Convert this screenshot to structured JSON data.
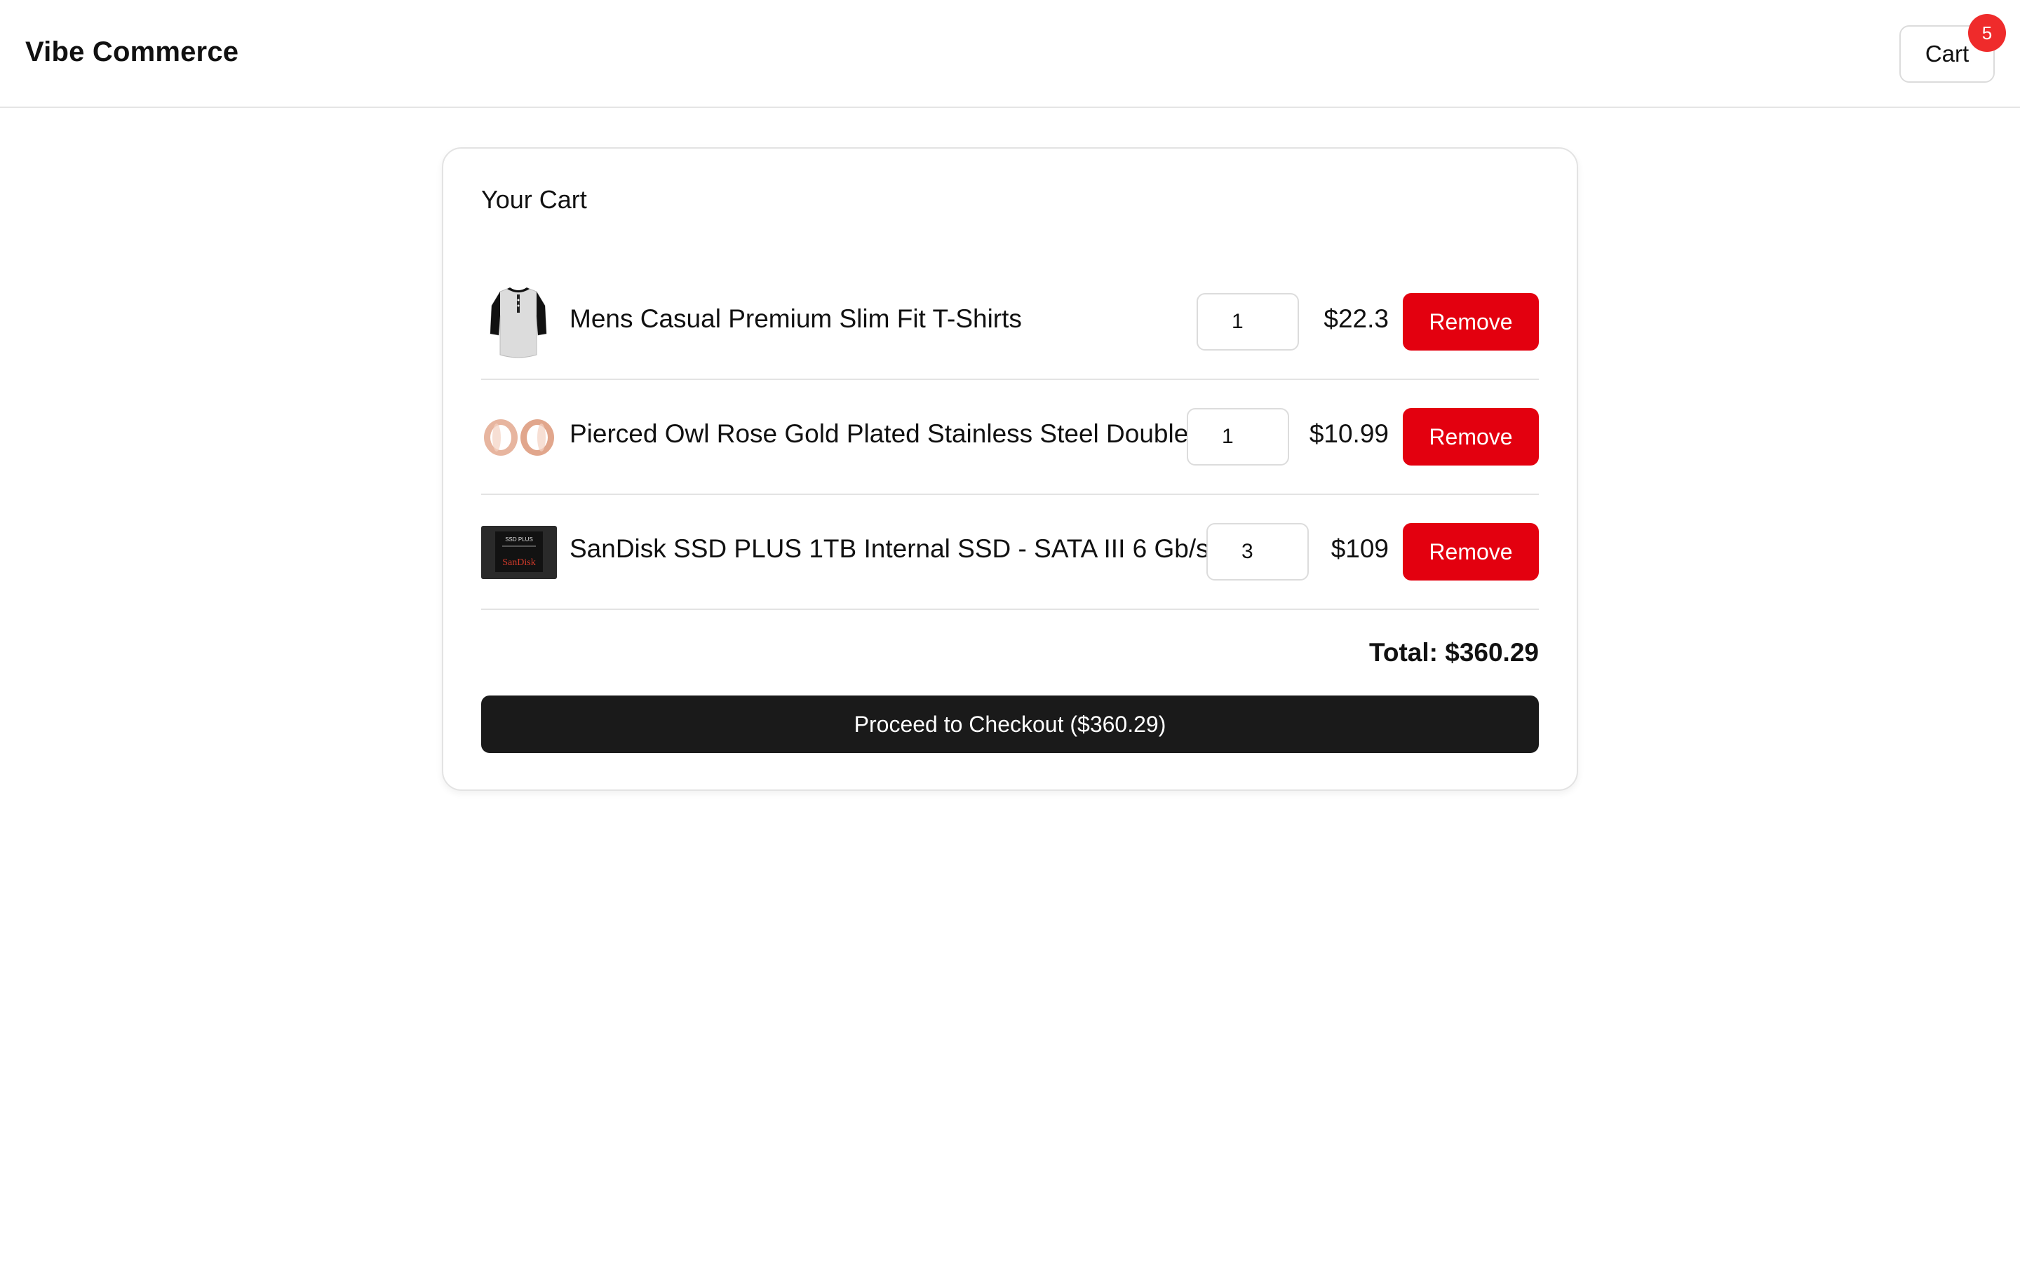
{
  "header": {
    "brand": "Vibe Commerce",
    "cart_label": "Cart",
    "cart_count": "5"
  },
  "cart": {
    "title": "Your Cart",
    "items": [
      {
        "name": "Mens Casual Premium Slim Fit T-Shirts",
        "quantity": "1",
        "price": "$22.3",
        "remove_label": "Remove",
        "image_icon": "tshirt-icon"
      },
      {
        "name": "Pierced Owl Rose Gold Plated Stainless Steel Double",
        "quantity": "1",
        "price": "$10.99",
        "remove_label": "Remove",
        "image_icon": "rings-icon"
      },
      {
        "name": "SanDisk SSD PLUS 1TB Internal SSD - SATA III 6 Gb/s",
        "quantity": "3",
        "price": "$109",
        "remove_label": "Remove",
        "image_icon": "ssd-icon",
        "image_label_top": "SSD PLUS",
        "image_label_brand": "SanDisk"
      }
    ],
    "total_label": "Total: $360.29",
    "checkout_label": "Proceed to Checkout ($360.29)"
  },
  "colors": {
    "remove_button": "#e3000f",
    "checkout_button": "#1a1a1a",
    "badge": "#ef2b2b"
  }
}
